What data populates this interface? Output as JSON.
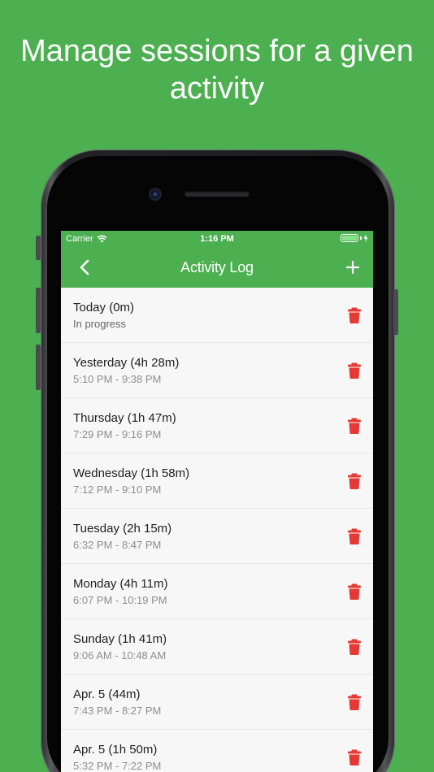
{
  "headline": "Manage sessions for a given activity",
  "colors": {
    "accent": "#4caf50",
    "delete": "#e53935",
    "background": "#f7f7f7"
  },
  "status_bar": {
    "carrier": "Carrier",
    "time": "1:16 PM"
  },
  "nav": {
    "back_icon": "chevron-left-icon",
    "title": "Activity Log",
    "add_icon": "plus-icon"
  },
  "sessions": [
    {
      "title": "Today (0m)",
      "subtitle": "In progress"
    },
    {
      "title": "Yesterday (4h 28m)",
      "subtitle": "5:10 PM - 9:38 PM"
    },
    {
      "title": "Thursday (1h 47m)",
      "subtitle": "7:29 PM - 9:16 PM"
    },
    {
      "title": "Wednesday (1h 58m)",
      "subtitle": "7:12 PM - 9:10 PM"
    },
    {
      "title": "Tuesday (2h 15m)",
      "subtitle": "6:32 PM - 8:47 PM"
    },
    {
      "title": "Monday (4h 11m)",
      "subtitle": "6:07 PM - 10:19 PM"
    },
    {
      "title": "Sunday (1h 41m)",
      "subtitle": "9:06 AM - 10:48 AM"
    },
    {
      "title": "Apr. 5 (44m)",
      "subtitle": "7:43 PM - 8:27 PM"
    },
    {
      "title": "Apr. 5 (1h 50m)",
      "subtitle": "5:32 PM - 7:22 PM"
    }
  ]
}
